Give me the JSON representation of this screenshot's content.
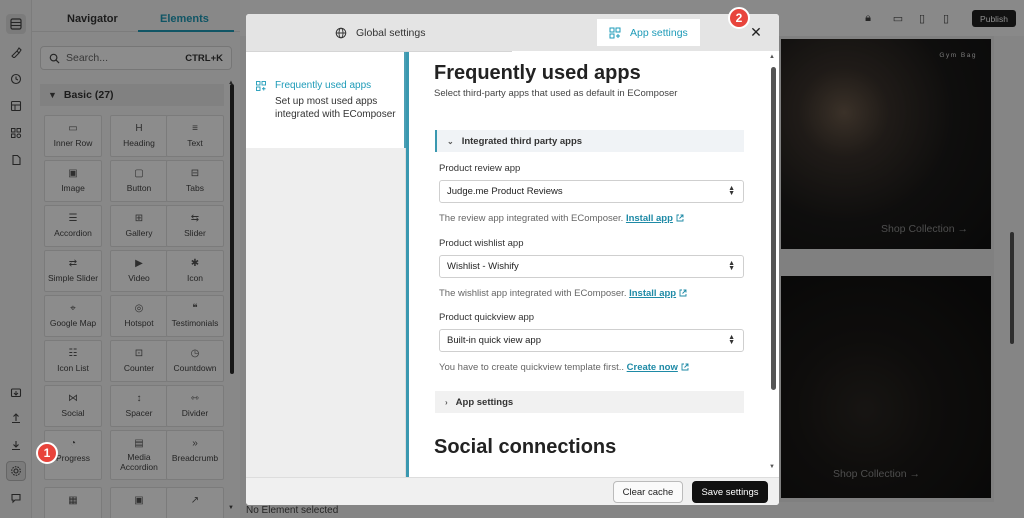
{
  "panel": {
    "tabs": [
      "Navigator",
      "Elements"
    ],
    "search_placeholder": "Search...",
    "search_shortcut": "CTRL+K",
    "section_label": "Basic (27)",
    "elements": [
      {
        "label": "Inner Row",
        "icon": "inner-row-icon",
        "glyph": "▭"
      },
      {
        "label": "Heading",
        "icon": "heading-icon",
        "glyph": "H"
      },
      {
        "label": "Text",
        "icon": "text-icon",
        "glyph": "≡"
      },
      {
        "label": "Image",
        "icon": "image-icon",
        "glyph": "▣"
      },
      {
        "label": "Button",
        "icon": "button-icon",
        "glyph": "▢"
      },
      {
        "label": "Tabs",
        "icon": "tabs-icon",
        "glyph": "⊟"
      },
      {
        "label": "Accordion",
        "icon": "accordion-icon",
        "glyph": "☰"
      },
      {
        "label": "Gallery",
        "icon": "gallery-icon",
        "glyph": "⊞"
      },
      {
        "label": "Slider",
        "icon": "slider-icon",
        "glyph": "⇆"
      },
      {
        "label": "Simple Slider",
        "icon": "simple-slider-icon",
        "glyph": "⇄"
      },
      {
        "label": "Video",
        "icon": "video-icon",
        "glyph": "▶"
      },
      {
        "label": "Icon",
        "icon": "icon-element-icon",
        "glyph": "✱"
      },
      {
        "label": "Google Map",
        "icon": "map-icon",
        "glyph": "⌖"
      },
      {
        "label": "Hotspot",
        "icon": "hotspot-icon",
        "glyph": "◎"
      },
      {
        "label": "Testimonials",
        "icon": "testimonials-icon",
        "glyph": "❝"
      },
      {
        "label": "Icon List",
        "icon": "icon-list-icon",
        "glyph": "☷"
      },
      {
        "label": "Counter",
        "icon": "counter-icon",
        "glyph": "⊡"
      },
      {
        "label": "Countdown",
        "icon": "countdown-icon",
        "glyph": "◷"
      },
      {
        "label": "Social",
        "icon": "social-icon",
        "glyph": "⋈"
      },
      {
        "label": "Spacer",
        "icon": "spacer-icon",
        "glyph": "↕"
      },
      {
        "label": "Divider",
        "icon": "divider-icon",
        "glyph": "⇿"
      },
      {
        "label": "Progress",
        "icon": "progress-icon",
        "glyph": "◔"
      },
      {
        "label": "Media Accordion",
        "icon": "media-accordion-icon",
        "glyph": "▤"
      },
      {
        "label": "Breadcrumb",
        "icon": "breadcrumb-icon",
        "glyph": "»"
      },
      {
        "label": "",
        "icon": "table-icon",
        "glyph": "▦"
      },
      {
        "label": "",
        "icon": "image-2-icon",
        "glyph": "▣"
      },
      {
        "label": "",
        "icon": "share-icon",
        "glyph": "↗"
      }
    ]
  },
  "badges": {
    "one": "1",
    "two": "2"
  },
  "topbar": {
    "publish_label": "Publish"
  },
  "canvas": {
    "photo_caption": "Gym Bag",
    "shop_collection_1": "Shop Collection →",
    "shop_collection_2": "Shop Collection →"
  },
  "status": {
    "no_element": "No Element selected"
  },
  "modal": {
    "tabs": {
      "global": "Global settings",
      "app": "App settings"
    },
    "sidebar": {
      "title": "Frequently used apps",
      "description": "Set up most used apps integrated with EComposer"
    },
    "main": {
      "title": "Frequently used apps",
      "subtitle": "Select third-party apps that used as default in EComposer",
      "accordion_integrated": "Integrated third party apps",
      "fields": [
        {
          "label": "Product review app",
          "value": "Judge.me Product Reviews",
          "help": "The review app integrated with EComposer.",
          "link": "Install app"
        },
        {
          "label": "Product wishlist app",
          "value": "Wishlist - Wishify",
          "help": "The wishlist app integrated with EComposer.",
          "link": "Install app"
        },
        {
          "label": "Product quickview app",
          "value": "Built-in quick view app",
          "help": "You have to create quickview template first..",
          "link": "Create now"
        }
      ],
      "accordion_app_settings": "App settings",
      "section2_title": "Social connections"
    },
    "footer": {
      "clear_cache": "Clear cache",
      "save_settings": "Save settings"
    }
  },
  "colors": {
    "accent": "#1e9bb8",
    "badge": "#e8443c",
    "primary_button": "#111111"
  }
}
